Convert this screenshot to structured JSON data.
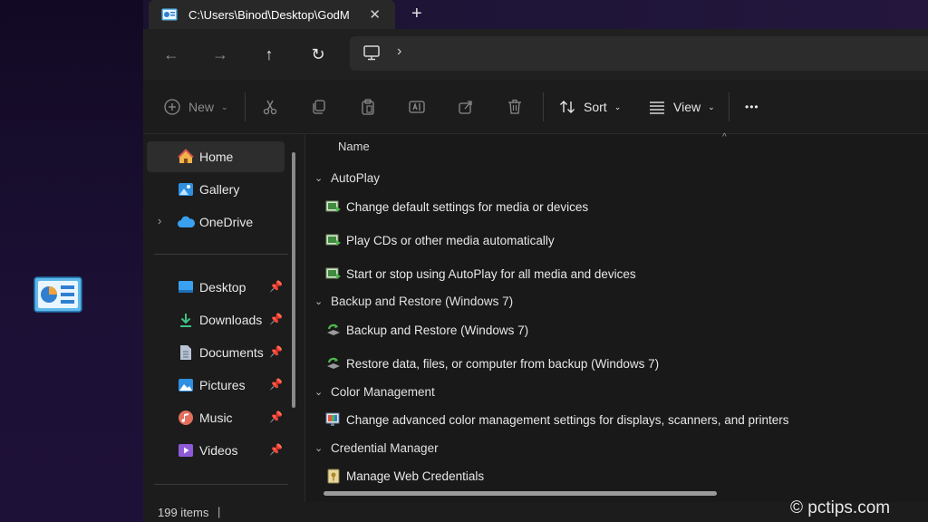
{
  "tab": {
    "title": "C:\\Users\\Binod\\Desktop\\GodM",
    "close": "✕",
    "new_tab": "+"
  },
  "navbar": {
    "back": "←",
    "forward": "→",
    "up": "↑",
    "refresh": "↻",
    "address_chevron": "›"
  },
  "commandbar": {
    "new_label": "New",
    "sort_label": "Sort",
    "view_label": "View",
    "more": "•••",
    "caret": "⌄"
  },
  "sidebar": {
    "items": [
      {
        "label": "Home",
        "icon": "home-icon"
      },
      {
        "label": "Gallery",
        "icon": "gallery-icon"
      },
      {
        "label": "OneDrive",
        "icon": "onedrive-icon",
        "expand": "›"
      },
      {
        "label": "Desktop",
        "icon": "desktop-folder-icon"
      },
      {
        "label": "Downloads",
        "icon": "downloads-icon"
      },
      {
        "label": "Documents",
        "icon": "documents-icon"
      },
      {
        "label": "Pictures",
        "icon": "pictures-icon"
      },
      {
        "label": "Music",
        "icon": "music-icon"
      },
      {
        "label": "Videos",
        "icon": "videos-icon"
      }
    ],
    "pin": "📌"
  },
  "content": {
    "column_name": "Name",
    "sort_arrow": "^",
    "group_chevron": "⌄",
    "groups": [
      {
        "label": "AutoPlay",
        "items": [
          "Change default settings for media or devices",
          "Play CDs or other media automatically",
          "Start or stop using AutoPlay for all media and devices"
        ]
      },
      {
        "label": "Backup and Restore (Windows 7)",
        "items": [
          "Backup and Restore (Windows 7)",
          "Restore data, files, or computer from backup (Windows 7)"
        ]
      },
      {
        "label": "Color Management",
        "items": [
          "Change advanced color management settings for displays, scanners, and printers"
        ]
      },
      {
        "label": "Credential Manager",
        "items": [
          "Manage Web Credentials"
        ]
      }
    ]
  },
  "status": {
    "count": "199 items",
    "sep": "|"
  },
  "watermark": "© pctips.com",
  "colors": {
    "accent": "#60cdff",
    "selected": "#2d2d2d"
  }
}
